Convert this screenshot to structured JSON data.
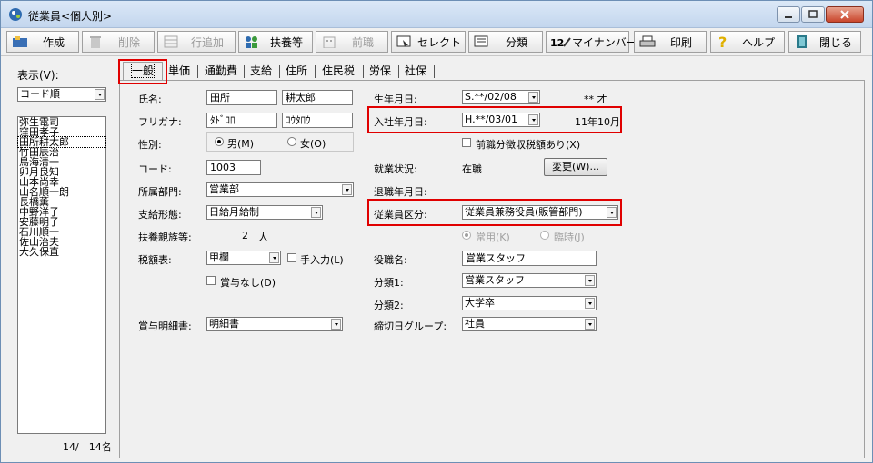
{
  "window": {
    "title": "従業員<個人別>"
  },
  "toolbar": {
    "create": "作成",
    "delete": "削除",
    "add_row": "行追加",
    "dependents": "扶養等",
    "prev_job": "前職",
    "select": "セレクト",
    "category": "分類",
    "my_number": "マイナンバー",
    "print": "印刷",
    "help": "ヘルプ",
    "close": "閉じる"
  },
  "left": {
    "display_label": "表示(V):",
    "sort_value": "コード順",
    "employees": [
      "弥生電司",
      "窪田孝子",
      "田所耕太郎",
      "竹田辰治",
      "鳥海清一",
      "卯月良知",
      "山本尚幸",
      "山名順一朗",
      "長橋薫",
      "中野洋子",
      "安藤明子",
      "石川順一",
      "佐山治夫",
      "大久保直"
    ],
    "selected_index": 2,
    "count": "14/　14名"
  },
  "tabs": [
    "一般",
    "単価",
    "通勤費",
    "支給",
    "住所",
    "住民税",
    "労保",
    "社保"
  ],
  "form": {
    "name_label": "氏名:",
    "last_name": "田所",
    "first_name": "耕太郎",
    "furigana_label": "フリガナ:",
    "furigana_last": "ﾀﾄﾞｺﾛ",
    "furigana_first": "ｺｳﾀﾛｳ",
    "gender_label": "性別:",
    "male": "男(M)",
    "female": "女(O)",
    "code_label": "コード:",
    "code": "1003",
    "dept_label": "所属部門:",
    "dept": "営業部",
    "pay_type_label": "支給形態:",
    "pay_type": "日給月給制",
    "dependents_label": "扶養親族等:",
    "dependents_count": "2",
    "dependents_unit": "人",
    "tax_table_label": "税額表:",
    "tax_table": "甲欄",
    "manual_input": "手入力(L)",
    "no_bonus": "賞与なし(D)",
    "bonus_statement_label": "賞与明細書:",
    "bonus_statement": "明細書",
    "birth_label": "生年月日:",
    "birth_date": "S.**/02/08",
    "age": "** 才",
    "hire_label": "入社年月日:",
    "hire_date": "H.**/03/01",
    "tenure": "11年10月",
    "prev_tax": "前職分徴収税額あり(X)",
    "status_label": "就業状況:",
    "status": "在職",
    "change_button": "変更(W)...",
    "retire_label": "退職年月日:",
    "emp_class_label": "従業員区分:",
    "emp_class": "従業員兼務役員(販管部門)",
    "regular": "常用(K)",
    "temp": "臨時(J)",
    "position_label": "役職名:",
    "position": "営業スタッフ",
    "class1_label": "分類1:",
    "class1": "営業スタッフ",
    "class2_label": "分類2:",
    "class2": "大学卒",
    "closing_label": "締切日グループ:",
    "closing": "社員"
  },
  "colors": {
    "highlight": "#e00000",
    "title_bg": "#c3d6ee"
  }
}
